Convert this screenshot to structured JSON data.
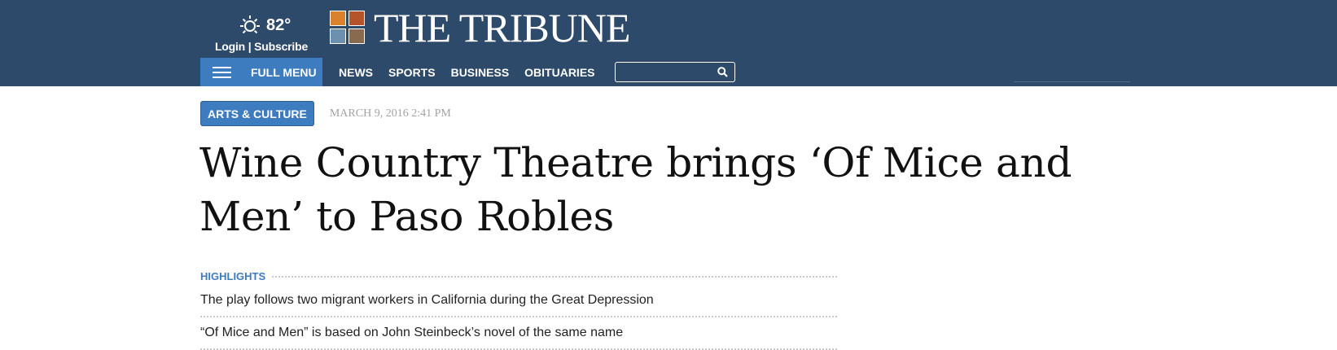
{
  "header": {
    "weather": {
      "icon": "sun-icon",
      "temperature": "82°"
    },
    "login_label": "Login",
    "separator": "|",
    "subscribe_label": "Subscribe",
    "logo_text": "THE TRIBUNE",
    "background_color": "#2e4a6b"
  },
  "nav": {
    "full_menu_label": "FULL MENU",
    "links": [
      "NEWS",
      "SPORTS",
      "BUSINESS",
      "OBITUARIES"
    ],
    "search": {
      "value": "",
      "placeholder": ""
    },
    "accent_color": "#3e7cc0"
  },
  "article": {
    "category": "ARTS & CULTURE",
    "date": "MARCH 9, 2016 2:41 PM",
    "headline": "Wine Country Theatre brings ‘Of Mice and Men’ to Paso Robles",
    "highlights_label": "HIGHLIGHTS",
    "highlights": [
      "The play follows two migrant workers in California during the Great Depression",
      "“Of Mice and Men” is based on John Steinbeck’s novel of the same name"
    ]
  }
}
